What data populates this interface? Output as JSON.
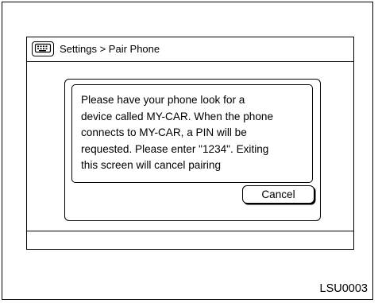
{
  "header": {
    "icon": "phone-keypad-icon",
    "breadcrumb": "Settings > Pair Phone"
  },
  "dialog": {
    "message": "Please have your phone look for a\ndevice called MY-CAR. When the phone\nconnects to MY-CAR, a PIN will be\nrequested. Please enter \"1234\". Exiting\nthis screen will cancel pairing",
    "cancel_label": "Cancel"
  },
  "figure_code": "LSU0003"
}
